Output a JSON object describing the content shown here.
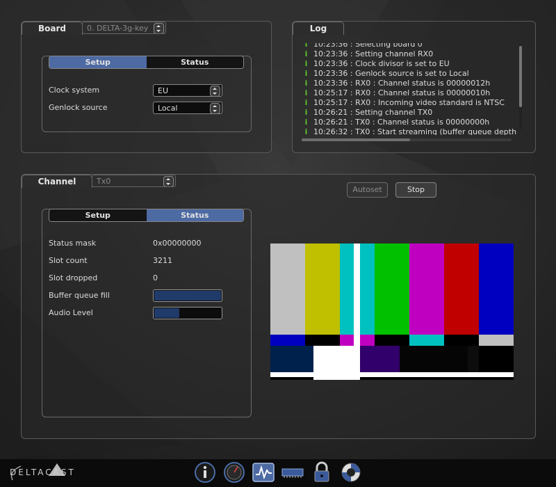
{
  "colors": {
    "accent": "#4d6aa3",
    "log_icon": "#5fc22d",
    "bar_fill": "#203a6a"
  },
  "board": {
    "title": "Board",
    "selector_value": "0. DELTA-3g-key",
    "tabs": [
      {
        "label": "Setup",
        "selected": true
      },
      {
        "label": "Status",
        "selected": false
      }
    ],
    "fields": [
      {
        "label": "Clock system",
        "value": "EU"
      },
      {
        "label": "Genlock source",
        "value": "Local"
      }
    ]
  },
  "log": {
    "title": "Log",
    "icon": "info-icon",
    "lines": [
      "10:23:36 : Selecting board 0",
      "10:23:36 : Setting channel RX0",
      "10:23:36 : Clock divisor is set to EU",
      "10:23:36 : Genlock source is set to Local",
      "10:23:36 : RX0 : Channel status is 00000012h",
      "10:25:17 : RX0 : Channel status is 00000010h",
      "10:25:17 : RX0 : Incoming video standard is NTSC",
      "10:26:21 : Setting channel TX0",
      "10:26:21 : TX0 : Channel status is 00000000h",
      "10:26:32 : TX0 : Start streaming (buffer queue depth"
    ]
  },
  "channel": {
    "title": "Channel",
    "selector_value": "Tx0",
    "buttons": {
      "autoset": "Autoset",
      "stop": "Stop"
    },
    "tabs": [
      {
        "label": "Setup",
        "selected": false
      },
      {
        "label": "Status",
        "selected": true
      }
    ],
    "status": [
      {
        "label": "Status mask",
        "value": "0x00000000"
      },
      {
        "label": "Slot count",
        "value": "3211"
      },
      {
        "label": "Slot dropped",
        "value": "0"
      }
    ],
    "bars": [
      {
        "label": "Buffer queue fill",
        "fraction": 1.0
      },
      {
        "label": "Audio Level",
        "fraction": 0.39
      }
    ]
  },
  "footer": {
    "logo_text": "DELTACAST",
    "icons": [
      "info-icon",
      "gauge-icon",
      "waveform-icon",
      "memory-icon",
      "lock-icon",
      "lifebuoy-icon"
    ]
  }
}
